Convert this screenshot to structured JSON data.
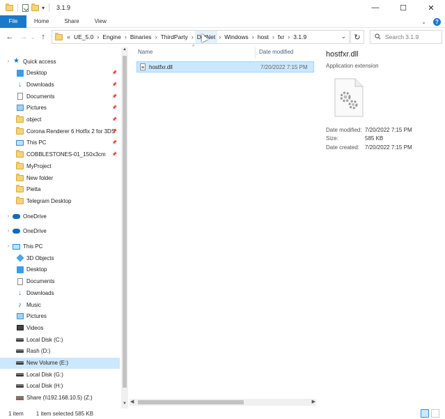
{
  "window": {
    "title": "3.1.9",
    "controls": {
      "minimize": "—",
      "maximize": "☐",
      "close": "✕"
    }
  },
  "ribbon": {
    "tabs": [
      "File",
      "Home",
      "Share",
      "View"
    ],
    "collapse": "⌄",
    "help": "?"
  },
  "address": {
    "back": "←",
    "forward": "→",
    "recent": "⌄",
    "up": "↑",
    "overflow": "«",
    "breadcrumbs": [
      "UE_5.0",
      "Engine",
      "Binaries",
      "ThirdParty",
      "DotNet",
      "Windows",
      "host",
      "fxr",
      "3.1.9"
    ],
    "dropdown": "⌄",
    "refresh": "↻",
    "search_placeholder": "Search 3.1.9"
  },
  "nav": {
    "quick_access": "Quick access",
    "quick_items": [
      {
        "label": "Desktop",
        "icon": "desktop-icon",
        "pinned": true
      },
      {
        "label": "Downloads",
        "icon": "downloads-icon",
        "pinned": true
      },
      {
        "label": "Documents",
        "icon": "documents-icon",
        "pinned": true
      },
      {
        "label": "Pictures",
        "icon": "pictures-icon",
        "pinned": true
      },
      {
        "label": "object",
        "icon": "folder-icon",
        "pinned": true
      },
      {
        "label": "Corona Renderer 6 Hotfix 2 for 3DS",
        "icon": "folder-icon",
        "pinned": true
      },
      {
        "label": "This PC",
        "icon": "pc-icon",
        "pinned": true
      },
      {
        "label": "COBBLESTONES-01_150x3cm",
        "icon": "folder-icon",
        "pinned": true
      },
      {
        "label": "MyProject",
        "icon": "folder-icon",
        "pinned": false
      },
      {
        "label": "New folder",
        "icon": "folder-icon",
        "pinned": false
      },
      {
        "label": "Pietta",
        "icon": "folder-icon",
        "pinned": false
      },
      {
        "label": "Telegram Desktop",
        "icon": "folder-icon",
        "pinned": false
      }
    ],
    "onedrive_1": "OneDrive",
    "onedrive_2": "OneDrive",
    "this_pc": "This PC",
    "pc_items": [
      {
        "label": "3D Objects",
        "icon": "3d-objects-icon"
      },
      {
        "label": "Desktop",
        "icon": "desktop-icon"
      },
      {
        "label": "Documents",
        "icon": "documents-icon"
      },
      {
        "label": "Downloads",
        "icon": "downloads-icon"
      },
      {
        "label": "Music",
        "icon": "music-icon"
      },
      {
        "label": "Pictures",
        "icon": "pictures-icon"
      },
      {
        "label": "Videos",
        "icon": "videos-icon"
      },
      {
        "label": "Local Disk (C:)",
        "icon": "drive-icon"
      },
      {
        "label": "Rash (D:)",
        "icon": "drive-icon"
      },
      {
        "label": "New Volume (E:)",
        "icon": "drive-icon",
        "selected": true
      },
      {
        "label": "Local Disk (G:)",
        "icon": "drive-icon"
      },
      {
        "label": "Local Disk (H:)",
        "icon": "drive-icon"
      },
      {
        "label": "Share (\\\\192.168.10.5) (Z:)",
        "icon": "network-drive-icon"
      }
    ]
  },
  "filelist": {
    "columns": [
      "Name",
      "Date modified"
    ],
    "sort_indicator": "^",
    "rows": [
      {
        "name": "hostfxr.dll",
        "date": "7/20/2022 7:15 PM",
        "selected": true
      }
    ]
  },
  "details": {
    "name": "hostfxr.dll",
    "type": "Application extension",
    "props": [
      {
        "key": "Date modified:",
        "value": "7/20/2022 7:15 PM"
      },
      {
        "key": "Size:",
        "value": "585 KB"
      },
      {
        "key": "Date created:",
        "value": "7/20/2022 7:15 PM"
      }
    ]
  },
  "status": {
    "count": "1 item",
    "selection": "1 item selected  585 KB"
  },
  "colors": {
    "accent": "#1979ca",
    "selection": "#cce8ff"
  }
}
